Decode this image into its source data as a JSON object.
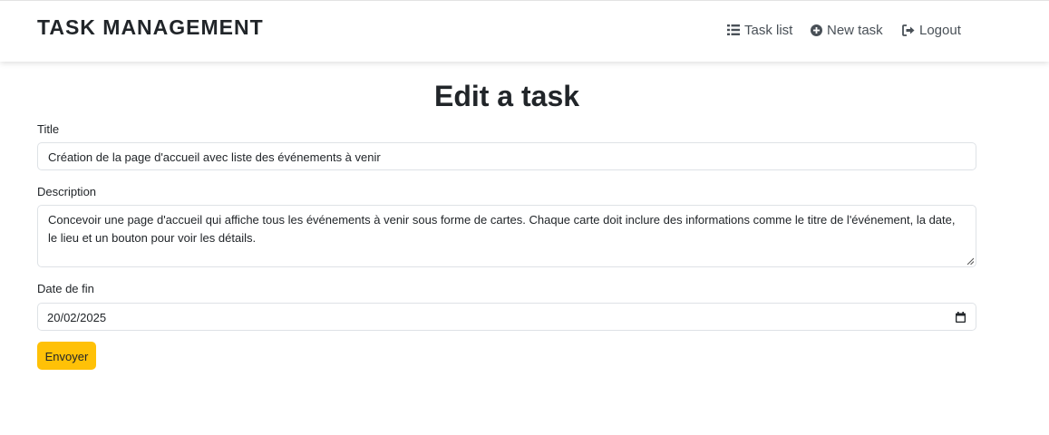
{
  "navbar": {
    "brand": "TASK MANAGEMENT",
    "items": [
      {
        "label": "Task list",
        "icon": "list-icon"
      },
      {
        "label": "New task",
        "icon": "plus-circle-icon"
      },
      {
        "label": "Logout",
        "icon": "logout-icon"
      }
    ]
  },
  "form": {
    "heading": "Edit a task",
    "title_label": "Title",
    "title_value": "Création de la page d'accueil avec liste des événements à venir",
    "description_label": "Description",
    "description_value": "Concevoir une page d'accueil qui affiche tous les événements à venir sous forme de cartes. Chaque carte doit inclure des informations comme le titre de l'événement, la date, le lieu et un bouton pour voir les détails.",
    "date_label": "Date de fin",
    "date_value": "20/02/2025",
    "submit_label": "Envoyer"
  },
  "colors": {
    "accent": "#ffc107",
    "text": "#212529",
    "border": "#dee2e6"
  }
}
